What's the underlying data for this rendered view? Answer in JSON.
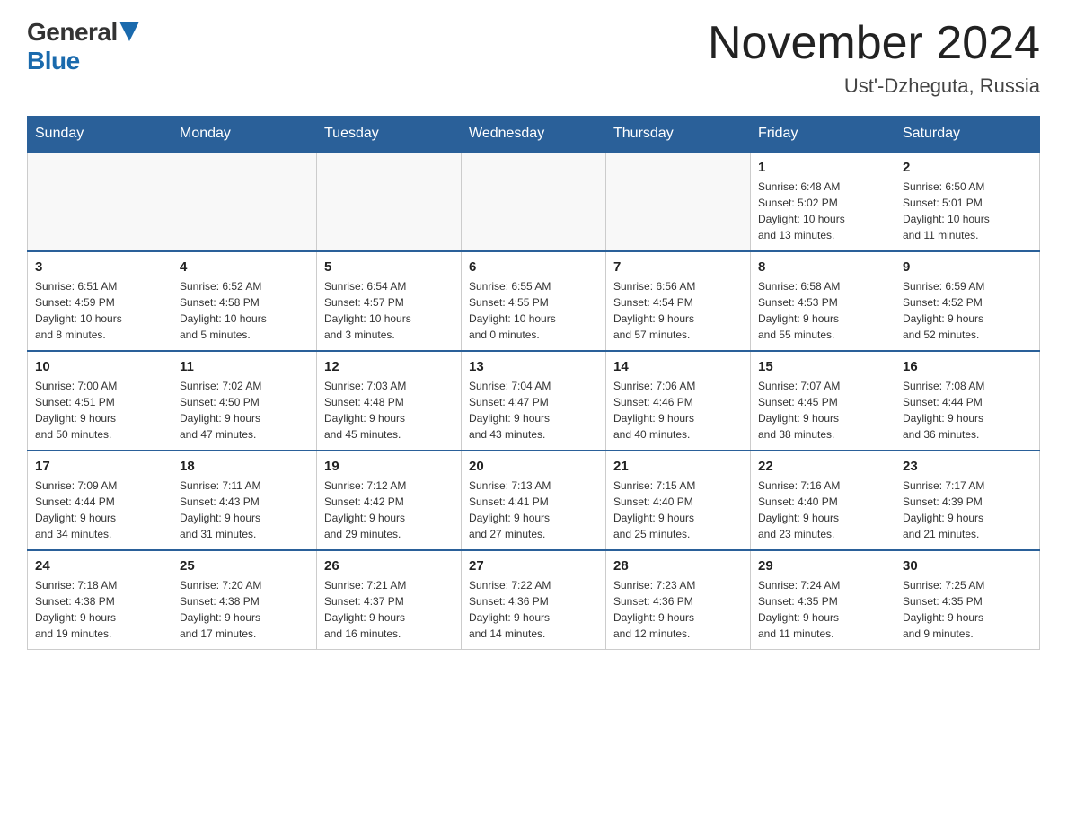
{
  "header": {
    "logo_general": "General",
    "logo_blue": "Blue",
    "title": "November 2024",
    "subtitle": "Ust'-Dzheguta, Russia"
  },
  "weekdays": [
    "Sunday",
    "Monday",
    "Tuesday",
    "Wednesday",
    "Thursday",
    "Friday",
    "Saturday"
  ],
  "weeks": [
    [
      {
        "day": "",
        "info": ""
      },
      {
        "day": "",
        "info": ""
      },
      {
        "day": "",
        "info": ""
      },
      {
        "day": "",
        "info": ""
      },
      {
        "day": "",
        "info": ""
      },
      {
        "day": "1",
        "info": "Sunrise: 6:48 AM\nSunset: 5:02 PM\nDaylight: 10 hours\nand 13 minutes."
      },
      {
        "day": "2",
        "info": "Sunrise: 6:50 AM\nSunset: 5:01 PM\nDaylight: 10 hours\nand 11 minutes."
      }
    ],
    [
      {
        "day": "3",
        "info": "Sunrise: 6:51 AM\nSunset: 4:59 PM\nDaylight: 10 hours\nand 8 minutes."
      },
      {
        "day": "4",
        "info": "Sunrise: 6:52 AM\nSunset: 4:58 PM\nDaylight: 10 hours\nand 5 minutes."
      },
      {
        "day": "5",
        "info": "Sunrise: 6:54 AM\nSunset: 4:57 PM\nDaylight: 10 hours\nand 3 minutes."
      },
      {
        "day": "6",
        "info": "Sunrise: 6:55 AM\nSunset: 4:55 PM\nDaylight: 10 hours\nand 0 minutes."
      },
      {
        "day": "7",
        "info": "Sunrise: 6:56 AM\nSunset: 4:54 PM\nDaylight: 9 hours\nand 57 minutes."
      },
      {
        "day": "8",
        "info": "Sunrise: 6:58 AM\nSunset: 4:53 PM\nDaylight: 9 hours\nand 55 minutes."
      },
      {
        "day": "9",
        "info": "Sunrise: 6:59 AM\nSunset: 4:52 PM\nDaylight: 9 hours\nand 52 minutes."
      }
    ],
    [
      {
        "day": "10",
        "info": "Sunrise: 7:00 AM\nSunset: 4:51 PM\nDaylight: 9 hours\nand 50 minutes."
      },
      {
        "day": "11",
        "info": "Sunrise: 7:02 AM\nSunset: 4:50 PM\nDaylight: 9 hours\nand 47 minutes."
      },
      {
        "day": "12",
        "info": "Sunrise: 7:03 AM\nSunset: 4:48 PM\nDaylight: 9 hours\nand 45 minutes."
      },
      {
        "day": "13",
        "info": "Sunrise: 7:04 AM\nSunset: 4:47 PM\nDaylight: 9 hours\nand 43 minutes."
      },
      {
        "day": "14",
        "info": "Sunrise: 7:06 AM\nSunset: 4:46 PM\nDaylight: 9 hours\nand 40 minutes."
      },
      {
        "day": "15",
        "info": "Sunrise: 7:07 AM\nSunset: 4:45 PM\nDaylight: 9 hours\nand 38 minutes."
      },
      {
        "day": "16",
        "info": "Sunrise: 7:08 AM\nSunset: 4:44 PM\nDaylight: 9 hours\nand 36 minutes."
      }
    ],
    [
      {
        "day": "17",
        "info": "Sunrise: 7:09 AM\nSunset: 4:44 PM\nDaylight: 9 hours\nand 34 minutes."
      },
      {
        "day": "18",
        "info": "Sunrise: 7:11 AM\nSunset: 4:43 PM\nDaylight: 9 hours\nand 31 minutes."
      },
      {
        "day": "19",
        "info": "Sunrise: 7:12 AM\nSunset: 4:42 PM\nDaylight: 9 hours\nand 29 minutes."
      },
      {
        "day": "20",
        "info": "Sunrise: 7:13 AM\nSunset: 4:41 PM\nDaylight: 9 hours\nand 27 minutes."
      },
      {
        "day": "21",
        "info": "Sunrise: 7:15 AM\nSunset: 4:40 PM\nDaylight: 9 hours\nand 25 minutes."
      },
      {
        "day": "22",
        "info": "Sunrise: 7:16 AM\nSunset: 4:40 PM\nDaylight: 9 hours\nand 23 minutes."
      },
      {
        "day": "23",
        "info": "Sunrise: 7:17 AM\nSunset: 4:39 PM\nDaylight: 9 hours\nand 21 minutes."
      }
    ],
    [
      {
        "day": "24",
        "info": "Sunrise: 7:18 AM\nSunset: 4:38 PM\nDaylight: 9 hours\nand 19 minutes."
      },
      {
        "day": "25",
        "info": "Sunrise: 7:20 AM\nSunset: 4:38 PM\nDaylight: 9 hours\nand 17 minutes."
      },
      {
        "day": "26",
        "info": "Sunrise: 7:21 AM\nSunset: 4:37 PM\nDaylight: 9 hours\nand 16 minutes."
      },
      {
        "day": "27",
        "info": "Sunrise: 7:22 AM\nSunset: 4:36 PM\nDaylight: 9 hours\nand 14 minutes."
      },
      {
        "day": "28",
        "info": "Sunrise: 7:23 AM\nSunset: 4:36 PM\nDaylight: 9 hours\nand 12 minutes."
      },
      {
        "day": "29",
        "info": "Sunrise: 7:24 AM\nSunset: 4:35 PM\nDaylight: 9 hours\nand 11 minutes."
      },
      {
        "day": "30",
        "info": "Sunrise: 7:25 AM\nSunset: 4:35 PM\nDaylight: 9 hours\nand 9 minutes."
      }
    ]
  ]
}
